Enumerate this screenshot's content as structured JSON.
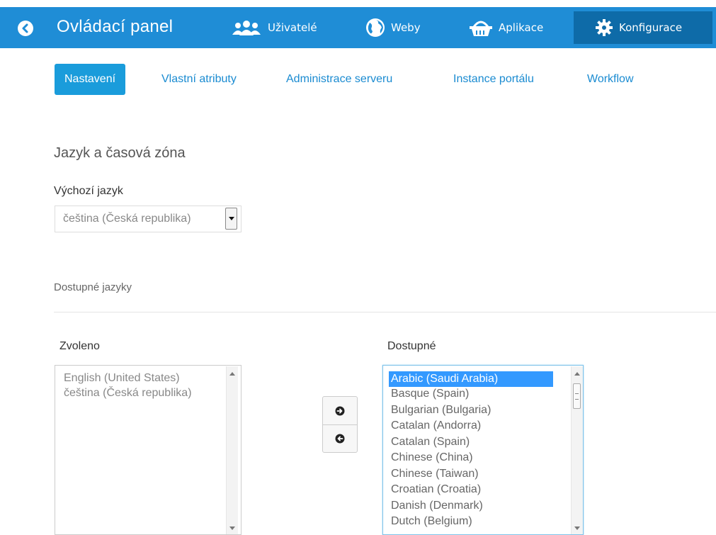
{
  "header": {
    "title": "Ovládací panel",
    "nav": {
      "users": "Uživatelé",
      "webs": "Weby",
      "apps": "Aplikace",
      "config": "Konfigurace"
    }
  },
  "tabs": [
    {
      "label": "Nastavení",
      "active": true
    },
    {
      "label": "Vlastní atributy"
    },
    {
      "label": "Administrace serveru"
    },
    {
      "label": "Instance portálu"
    },
    {
      "label": "Workflow"
    }
  ],
  "section": {
    "title": "Jazyk a časová zóna",
    "default_language_label": "Výchozí jazyk",
    "default_language_value": "čeština (Česká republika)",
    "available_languages_heading": "Dostupné jazyky"
  },
  "selected_list": {
    "label": "Zvoleno",
    "items": [
      "English (United States)",
      "čeština (Česká republika)"
    ]
  },
  "available_list": {
    "label": "Dostupné",
    "items": [
      "Arabic (Saudi Arabia)",
      "Basque (Spain)",
      "Bulgarian (Bulgaria)",
      "Catalan (Andorra)",
      "Catalan (Spain)",
      "Chinese (China)",
      "Chinese (Taiwan)",
      "Croatian (Croatia)",
      "Danish (Denmark)",
      "Dutch (Belgium)"
    ],
    "selected_item": "Arabic (Saudi Arabia)"
  },
  "colors": {
    "header_bg": "#1f8dd6",
    "active_nav_bg": "#0e6ba8",
    "accent": "#1a9cdb",
    "selection": "#3399ff"
  }
}
